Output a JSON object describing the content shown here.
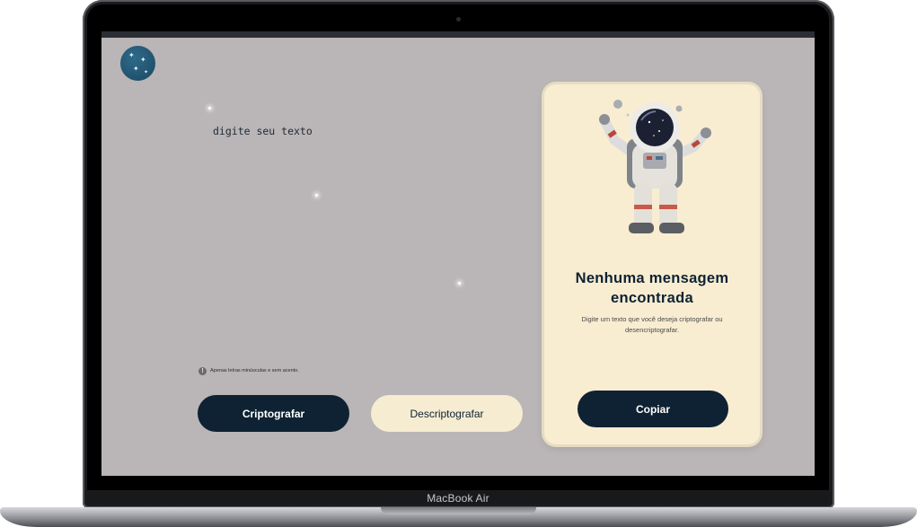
{
  "device": {
    "label": "MacBook Air"
  },
  "app": {
    "logo_icon": "night-sky-logo-icon",
    "input": {
      "placeholder": "digite seu texto",
      "value": ""
    },
    "hint": {
      "icon": "info-icon",
      "text": "Apenas letras minúsculas e sem acento."
    },
    "buttons": {
      "encrypt_label": "Criptografar",
      "decrypt_label": "Descriptografar"
    },
    "output_panel": {
      "illustration_icon": "astronaut-illustration",
      "title": "Nenhuma mensagem encontrada",
      "description": "Digite um texto que você deseja criptografar ou desencriptografar.",
      "copy_label": "Copiar"
    }
  },
  "colors": {
    "background": "#bab5b6",
    "primary_dark": "#0e2233",
    "accent_cream": "#f6ecd2",
    "panel": "#f8edd1"
  }
}
